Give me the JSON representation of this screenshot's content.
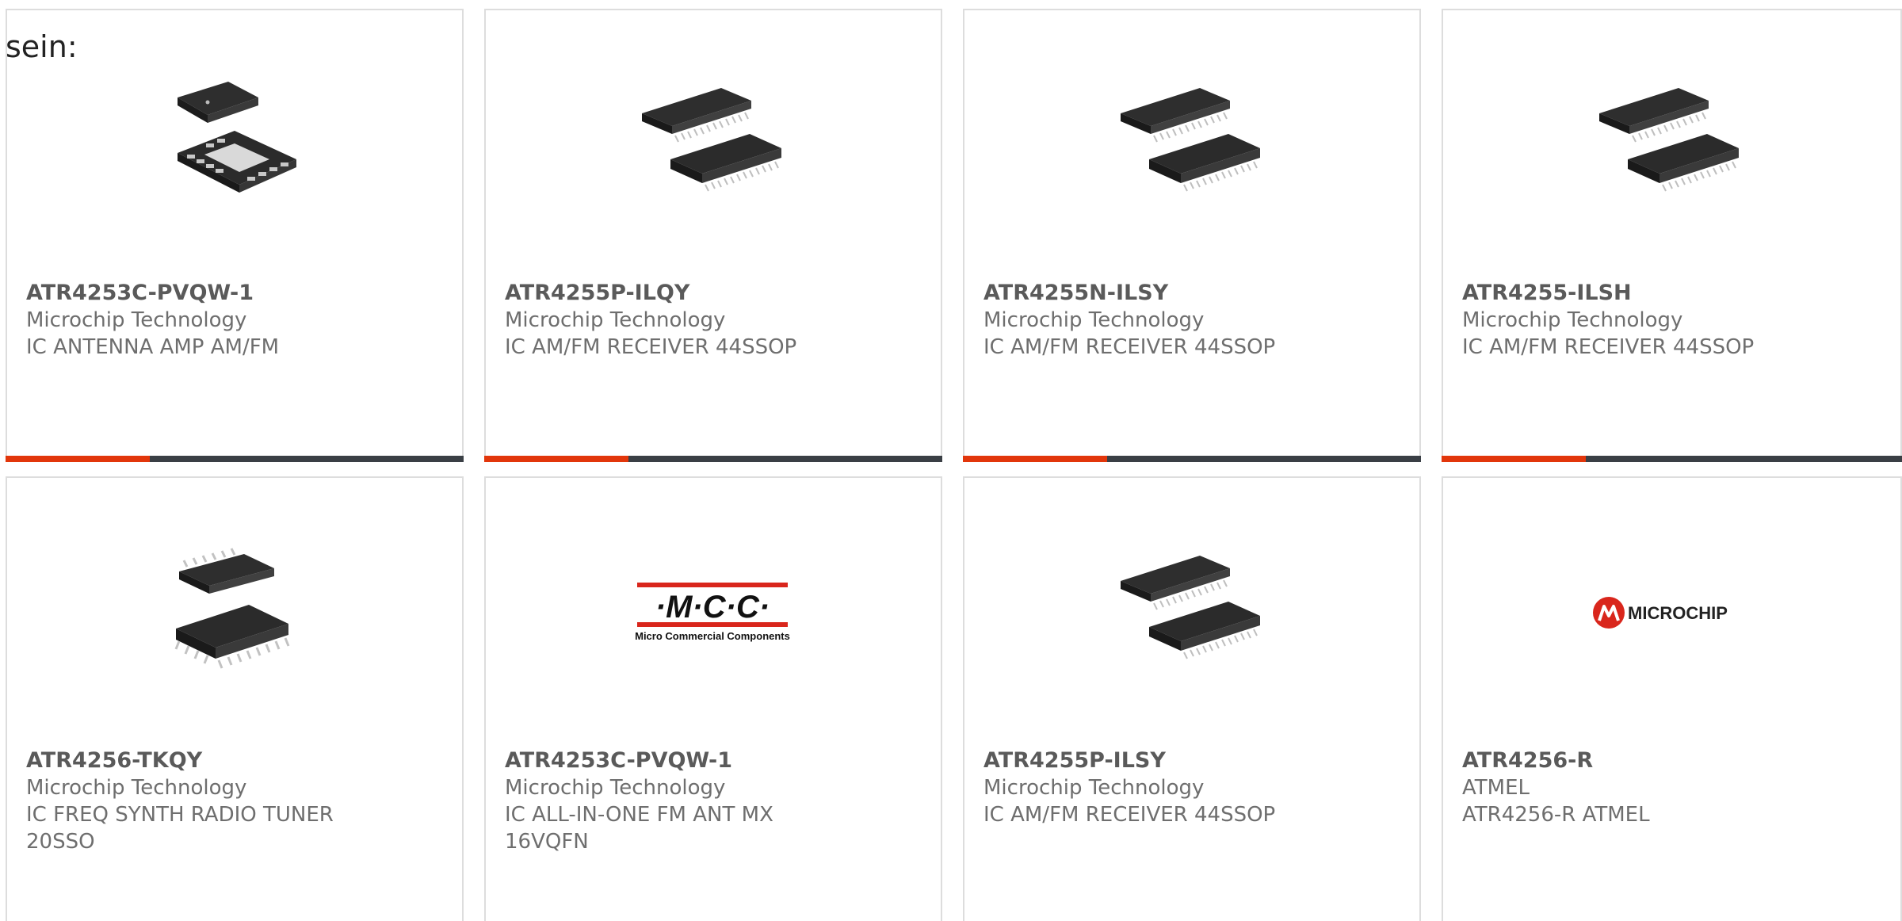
{
  "lead_text": "sein:",
  "colors": {
    "accent": "#e2360b",
    "bar": "#3a3f45",
    "border": "#dddddd"
  },
  "products": [
    {
      "part": "ATR4253C-PVQW-1",
      "manufacturer": "Microchip Technology",
      "description": "IC ANTENNA AMP AM/FM",
      "image": "qfn-chip-image"
    },
    {
      "part": "ATR4255P-ILQY",
      "manufacturer": "Microchip Technology",
      "description": "IC AM/FM RECEIVER 44SSOP",
      "image": "ssop-chip-image"
    },
    {
      "part": "ATR4255N-ILSY",
      "manufacturer": "Microchip Technology",
      "description": "IC AM/FM RECEIVER 44SSOP",
      "image": "ssop-chip-image"
    },
    {
      "part": "ATR4255-ILSH",
      "manufacturer": "Microchip Technology",
      "description": "IC AM/FM RECEIVER 44SSOP",
      "image": "ssop-chip-image"
    },
    {
      "part": "ATR4256-TKQY",
      "manufacturer": "Microchip Technology",
      "description": "IC FREQ SYNTH RADIO TUNER 20SSO",
      "image": "so-chip-image"
    },
    {
      "part": "ATR4253C-PVQW-1",
      "manufacturer": "Microchip Technology",
      "description": "IC ALL-IN-ONE FM ANT MX 16VQFN",
      "image": "mcc-logo",
      "logo_text": "·M·C·C·",
      "logo_subtext": "Micro Commercial Components"
    },
    {
      "part": "ATR4255P-ILSY",
      "manufacturer": "Microchip Technology",
      "description": "IC AM/FM RECEIVER 44SSOP",
      "image": "ssop-chip-image"
    },
    {
      "part": "ATR4256-R",
      "manufacturer": "ATMEL",
      "description": "ATR4256-R ATMEL",
      "image": "microchip-logo",
      "logo_text": "MICROCHIP"
    }
  ]
}
